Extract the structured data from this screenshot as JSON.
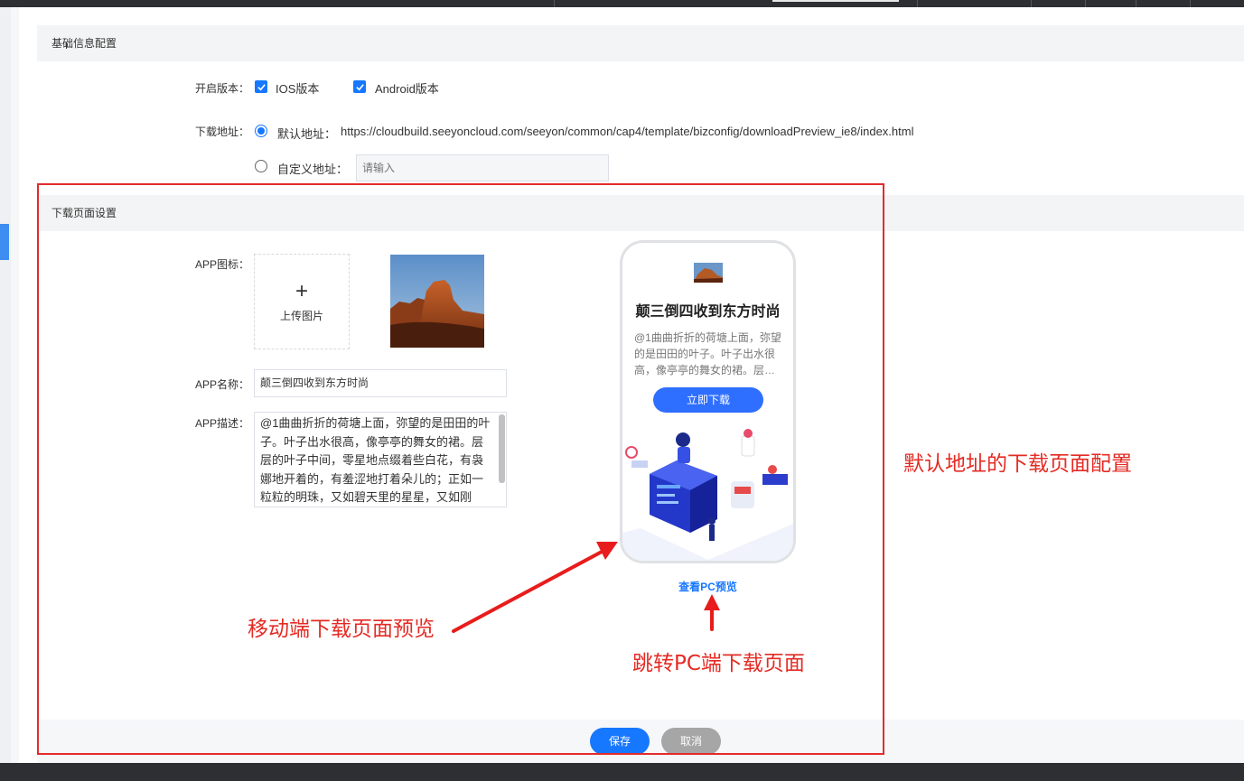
{
  "basic_section": {
    "title": "基础信息配置"
  },
  "version": {
    "label": "开启版本：",
    "ios_label": "IOS版本",
    "ios_checked": true,
    "android_label": "Android版本",
    "android_checked": true
  },
  "download_address": {
    "label": "下载地址：",
    "default_label": "默认地址：",
    "default_url": "https://cloudbuild.seeyoncloud.com/seeyon/common/cap4/template/bizconfig/downloadPreview_ie8/index.html",
    "default_selected": true,
    "custom_label": "自定义地址：",
    "custom_placeholder": "请输入",
    "custom_value": ""
  },
  "download_page_section": {
    "title": "下载页面设置"
  },
  "app_icon": {
    "label": "APP图标：",
    "upload_text": "上传图片",
    "plus": "+"
  },
  "app_name": {
    "label": "APP名称：",
    "value": "颠三倒四收到东方时尚"
  },
  "app_desc": {
    "label": "APP描述：",
    "value": "@1曲曲折折的荷塘上面，弥望的是田田的叶子。叶子出水很高，像亭亭的舞女的裙。层层的叶子中间，零星地点缀着些白花，有袅娜地开着的，有羞涩地打着朵儿的；正如一粒粒的明珠，又如碧天里的星星，又如刚"
  },
  "preview": {
    "title": "颠三倒四收到东方时尚",
    "desc": "@1曲曲折折的荷塘上面，弥望的是田田的叶子。叶子出水很高，像亭亭的舞女的裙。层…",
    "download_button": "立即下载",
    "pc_preview_link": "查看PC预览"
  },
  "footer": {
    "save": "保存",
    "cancel": "取消"
  },
  "annotations": {
    "default_config": "默认地址的下载页面配置",
    "mobile_preview": "移动端下载页面预览",
    "pc_jump": "跳转PC端下载页面"
  },
  "colors": {
    "primary": "#1677ff",
    "annotation": "#e42b24",
    "cancel": "#a6a6a6"
  }
}
